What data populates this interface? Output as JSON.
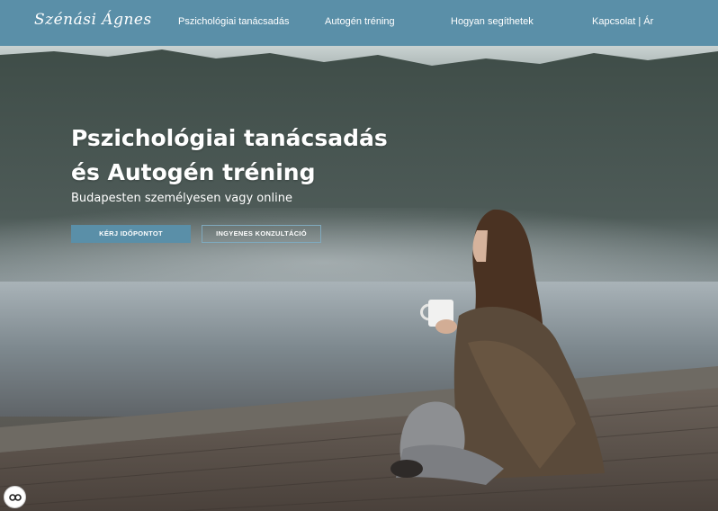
{
  "nav": {
    "logo": "Szénási Ágnes",
    "links": [
      {
        "label": "Pszichológiai tanácsadás"
      },
      {
        "label": "Autogén tréning"
      },
      {
        "label": "Hogyan segíthetek"
      },
      {
        "label": "Kapcsolat | Ár"
      }
    ],
    "background": "#5a8fa8"
  },
  "hero": {
    "title_line1": "Pszichológiai tanácsadás",
    "title_line2": "és Autogén tréning",
    "subtitle": "Budapesten személyesen vagy online",
    "primary_button": "KÉRJ IDŐPONTOT",
    "secondary_button": "INGYENES KONZULTÁCIÓ"
  },
  "cookie": {
    "icon": "cookie-consent-icon"
  }
}
